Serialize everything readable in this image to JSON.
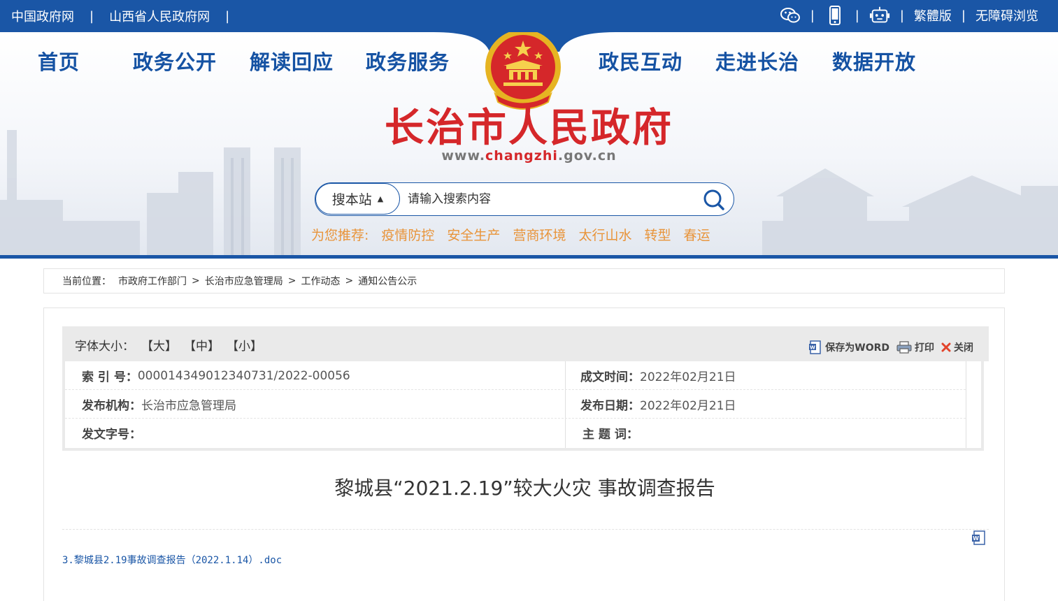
{
  "topbar": {
    "links": [
      "中国政府网",
      "山西省人民政府网"
    ],
    "right": {
      "traditional": "繁體版",
      "accessible": "无障碍浏览"
    },
    "icons": [
      "wechat-icon",
      "mobile-icon",
      "robot-icon"
    ]
  },
  "nav": {
    "items": [
      "首页",
      "政务公开",
      "解读回应",
      "政务服务",
      "政民互动",
      "走进长治",
      "数据开放"
    ]
  },
  "site": {
    "title": "长治市人民政府",
    "url_prefix": "www.",
    "url_highlight": "changzhi",
    "url_suffix": ".gov.cn"
  },
  "search": {
    "scope": "搜本站",
    "placeholder": "请输入搜索内容"
  },
  "recommend": {
    "label": "为您推荐:",
    "keywords": [
      "疫情防控",
      "安全生产",
      "营商环境",
      "太行山水",
      "转型",
      "春运"
    ]
  },
  "breadcrumb": {
    "label": "当前位置：",
    "items": [
      "市政府工作部门",
      "长治市应急管理局",
      "工作动态",
      "通知公告公示"
    ],
    "separator": ">"
  },
  "toolbar": {
    "fontsize_label": "字体大小：",
    "options": [
      "【大】",
      "【中】",
      "【小】"
    ],
    "save_word": "保存为WORD",
    "print": "打印",
    "close": "关闭"
  },
  "meta": {
    "index_label": "索 引 号：",
    "index_value": "000014349012340731/2022-00056",
    "created_label": "成文时间：",
    "created_value": "2022年02月21日",
    "publisher_label": "发布机构：",
    "publisher_value": "长治市应急管理局",
    "published_label": "发布日期：",
    "published_value": "2022年02月21日",
    "docno_label": "发文字号：",
    "docno_value": "",
    "subject_label": "主 题 词：",
    "subject_value": ""
  },
  "document": {
    "title": "黎城县“2021.2.19”较大火灾 事故调查报告",
    "attachment": "3.黎城县2.19事故调查报告（2022.1.14）.doc"
  },
  "colors": {
    "primary_blue": "#1a56a6",
    "title_red": "#d5272a",
    "recommend_orange": "#e8943a"
  }
}
